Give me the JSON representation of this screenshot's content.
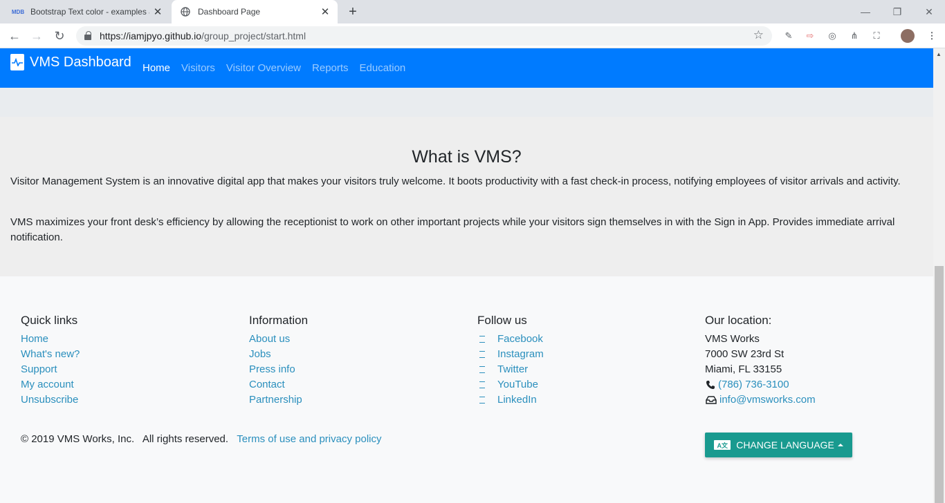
{
  "browser": {
    "tabs": [
      {
        "title": "Bootstrap Text color - examples &",
        "favicon": "MDB",
        "active": false
      },
      {
        "title": "Dashboard Page",
        "favicon": "globe-icon",
        "active": true
      }
    ],
    "url_host": "https://iamjpyo.github.io",
    "url_path": "/group_project/start.html"
  },
  "navbar": {
    "brand": "VMS Dashboard",
    "links": [
      "Home",
      "Visitors",
      "Visitor Overview",
      "Reports",
      "Education"
    ],
    "active_link": "Home",
    "color": "#007bff"
  },
  "about": {
    "title": "What is VMS?",
    "p1": "Visitor Management System is an innovative digital app that makes your visitors truly welcome. It boots productivity with a fast check-in process, notifying employees of visitor arrivals and activity.",
    "p2": "VMS maximizes your front desk’s efficiency by allowing the receptionist to work on other important projects while your visitors sign themselves in with the Sign in App. Provides immediate arrival notification."
  },
  "footer": {
    "quick_links": {
      "title": "Quick links",
      "items": [
        "Home",
        "What's new?",
        "Support",
        "My account",
        "Unsubscribe"
      ]
    },
    "information": {
      "title": "Information",
      "items": [
        "About us",
        "Jobs",
        "Press info",
        "Contact",
        "Partnership"
      ]
    },
    "follow": {
      "title": "Follow us",
      "items": [
        "Facebook",
        "Instagram",
        "Twitter",
        "YouTube",
        "LinkedIn"
      ]
    },
    "location": {
      "title": "Our location:",
      "company": "VMS Works",
      "street": "7000 SW 23rd St",
      "city": "Miami, FL 33155",
      "phone": "(786) 736-3100",
      "email": "info@vmsworks.com"
    },
    "copyright": "© 2019 VMS Works, Inc.   All rights reserved.",
    "terms": "Terms of use and privacy policy",
    "language_button": "CHANGE LANGUAGE",
    "link_color": "#2a8fbd",
    "button_color": "#199a8f"
  }
}
